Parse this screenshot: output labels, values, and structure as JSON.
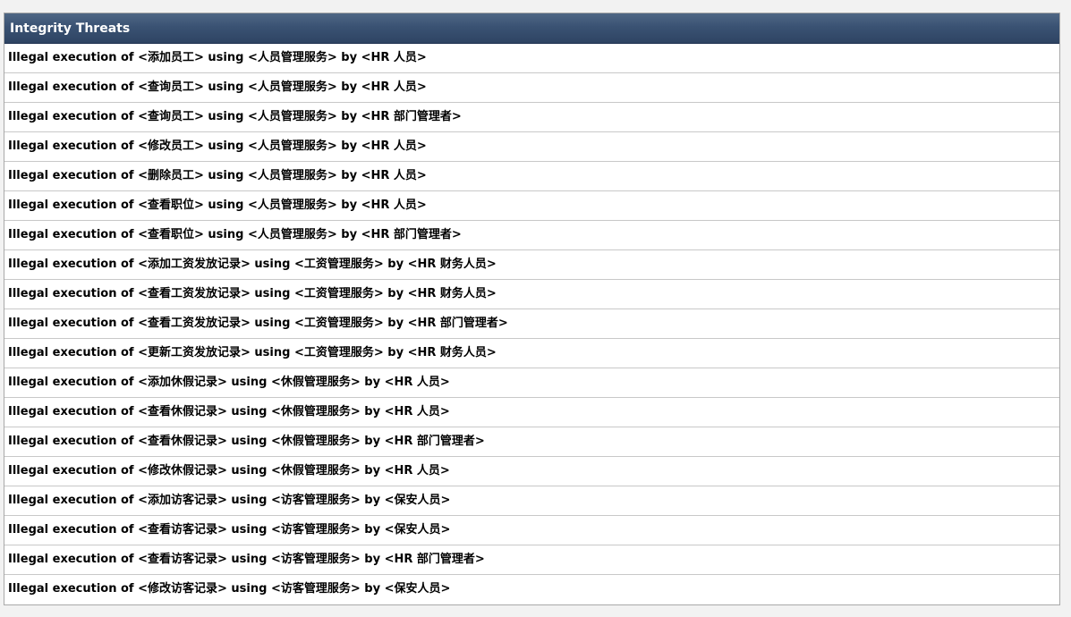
{
  "table": {
    "title": "Integrity Threats",
    "rows": [
      "Illegal execution of <添加员工> using <人员管理服务> by <HR 人员>",
      "Illegal execution of <查询员工> using <人员管理服务> by <HR 人员>",
      "Illegal execution of <查询员工> using <人员管理服务> by <HR 部门管理者>",
      "Illegal execution of <修改员工> using <人员管理服务> by <HR 人员>",
      "Illegal execution of <删除员工> using <人员管理服务> by <HR 人员>",
      "Illegal execution of <查看职位> using <人员管理服务> by <HR 人员>",
      "Illegal execution of <查看职位> using <人员管理服务> by <HR 部门管理者>",
      "Illegal execution of <添加工资发放记录> using <工资管理服务> by <HR 财务人员>",
      "Illegal execution of <查看工资发放记录> using <工资管理服务> by <HR 财务人员>",
      "Illegal execution of <查看工资发放记录> using <工资管理服务> by <HR 部门管理者>",
      "Illegal execution of <更新工资发放记录> using <工资管理服务> by <HR 财务人员>",
      "Illegal execution of <添加休假记录> using <休假管理服务> by <HR 人员>",
      "Illegal execution of <查看休假记录> using <休假管理服务> by <HR 人员>",
      "Illegal execution of <查看休假记录> using <休假管理服务> by <HR 部门管理者>",
      "Illegal execution of <修改休假记录> using <休假管理服务> by <HR 人员>",
      "Illegal execution of <添加访客记录> using <访客管理服务> by <保安人员>",
      "Illegal execution of <查看访客记录> using <访客管理服务> by <保安人员>",
      "Illegal execution of <查看访客记录> using <访客管理服务> by <HR 部门管理者>",
      "Illegal execution of <修改访客记录> using <访客管理服务> by <保安人员>"
    ]
  },
  "colors": {
    "header_bg": "#3a5273",
    "header_text": "#ffffff",
    "row_border": "#c8c8c8",
    "page_bg": "#f2f2f2"
  }
}
